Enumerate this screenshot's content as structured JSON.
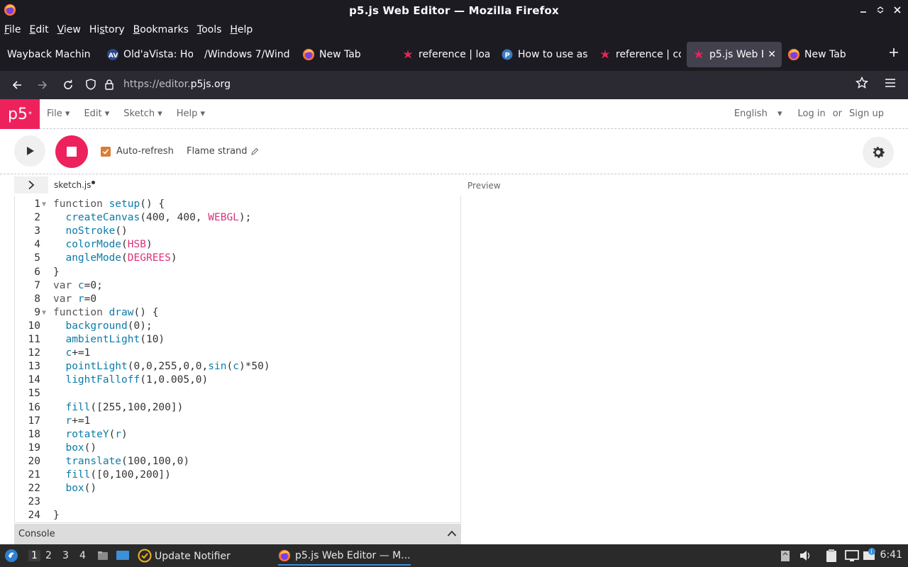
{
  "window": {
    "title": "p5.js Web Editor — Mozilla Firefox"
  },
  "menubar": [
    {
      "pre": "",
      "u": "F",
      "post": "ile"
    },
    {
      "pre": "",
      "u": "E",
      "post": "dit"
    },
    {
      "pre": "",
      "u": "V",
      "post": "iew"
    },
    {
      "pre": "Hi",
      "u": "s",
      "post": "tory"
    },
    {
      "pre": "",
      "u": "B",
      "post": "ookmarks"
    },
    {
      "pre": "",
      "u": "T",
      "post": "ools"
    },
    {
      "pre": "",
      "u": "H",
      "post": "elp"
    }
  ],
  "tabs": [
    {
      "label": "Wayback Machin",
      "icon": "none"
    },
    {
      "label": "Old'aVista: Ho",
      "icon": "av"
    },
    {
      "label": "/Windows 7/Wind",
      "icon": "none"
    },
    {
      "label": "New Tab",
      "icon": "firefox"
    },
    {
      "label": "reference | loa",
      "icon": "p5star"
    },
    {
      "label": "How to use as",
      "icon": "p"
    },
    {
      "label": "reference | co",
      "icon": "p5star"
    },
    {
      "label": "p5.js Web E",
      "icon": "p5star",
      "active": true
    },
    {
      "label": "New Tab",
      "icon": "firefox"
    }
  ],
  "urlbar": {
    "prefix": "https://editor.",
    "host": "p5js.org"
  },
  "p5": {
    "logo": "p5",
    "menu": [
      "File",
      "Edit",
      "Sketch",
      "Help"
    ],
    "language": "English",
    "login": "Log in",
    "or": "or",
    "signup": "Sign up"
  },
  "toolbar": {
    "autorefresh_label": "Auto-refresh",
    "autorefresh_checked": true,
    "sketch_name": "Flame strand"
  },
  "editor": {
    "file_name": "sketch.js",
    "preview_label": "Preview",
    "console_label": "Console",
    "lines": [
      {
        "n": "1",
        "fold": true,
        "tokens": [
          [
            "kw",
            "function "
          ],
          [
            "fn",
            "setup"
          ],
          [
            "plain",
            "() {"
          ]
        ]
      },
      {
        "n": "2",
        "tokens": [
          [
            "plain",
            "  "
          ],
          [
            "fn",
            "createCanvas"
          ],
          [
            "plain",
            "(400, 400, "
          ],
          [
            "const",
            "WEBGL"
          ],
          [
            "plain",
            ");"
          ]
        ]
      },
      {
        "n": "3",
        "tokens": [
          [
            "plain",
            "  "
          ],
          [
            "fn",
            "noStroke"
          ],
          [
            "plain",
            "()"
          ]
        ]
      },
      {
        "n": "4",
        "tokens": [
          [
            "plain",
            "  "
          ],
          [
            "fn",
            "colorMode"
          ],
          [
            "plain",
            "("
          ],
          [
            "const",
            "HSB"
          ],
          [
            "plain",
            ")"
          ]
        ]
      },
      {
        "n": "5",
        "tokens": [
          [
            "plain",
            "  "
          ],
          [
            "fn",
            "angleMode"
          ],
          [
            "plain",
            "("
          ],
          [
            "const",
            "DEGREES"
          ],
          [
            "plain",
            ")"
          ]
        ]
      },
      {
        "n": "6",
        "tokens": [
          [
            "plain",
            "}"
          ]
        ]
      },
      {
        "n": "7",
        "tokens": [
          [
            "kw",
            "var "
          ],
          [
            "fn",
            "c"
          ],
          [
            "plain",
            "=0;"
          ]
        ]
      },
      {
        "n": "8",
        "tokens": [
          [
            "kw",
            "var "
          ],
          [
            "fn",
            "r"
          ],
          [
            "plain",
            "=0"
          ]
        ]
      },
      {
        "n": "9",
        "fold": true,
        "tokens": [
          [
            "kw",
            "function "
          ],
          [
            "fn",
            "draw"
          ],
          [
            "plain",
            "() {"
          ]
        ]
      },
      {
        "n": "10",
        "tokens": [
          [
            "plain",
            "  "
          ],
          [
            "fn",
            "background"
          ],
          [
            "plain",
            "(0);"
          ]
        ]
      },
      {
        "n": "11",
        "tokens": [
          [
            "plain",
            "  "
          ],
          [
            "fn",
            "ambientLight"
          ],
          [
            "plain",
            "(10)"
          ]
        ]
      },
      {
        "n": "12",
        "tokens": [
          [
            "plain",
            "  "
          ],
          [
            "fn",
            "c"
          ],
          [
            "plain",
            "+=1"
          ]
        ]
      },
      {
        "n": "13",
        "tokens": [
          [
            "plain",
            "  "
          ],
          [
            "fn",
            "pointLight"
          ],
          [
            "plain",
            "(0,0,255,0,0,"
          ],
          [
            "fn",
            "sin"
          ],
          [
            "plain",
            "("
          ],
          [
            "fn",
            "c"
          ],
          [
            "plain",
            ")*50)"
          ]
        ]
      },
      {
        "n": "14",
        "tokens": [
          [
            "plain",
            "  "
          ],
          [
            "fn",
            "lightFalloff"
          ],
          [
            "plain",
            "(1,0.005,0)"
          ]
        ]
      },
      {
        "n": "15",
        "tokens": []
      },
      {
        "n": "16",
        "tokens": [
          [
            "plain",
            "  "
          ],
          [
            "fn",
            "fill"
          ],
          [
            "plain",
            "([255,100,200])"
          ]
        ]
      },
      {
        "n": "17",
        "tokens": [
          [
            "plain",
            "  "
          ],
          [
            "fn",
            "r"
          ],
          [
            "plain",
            "+=1"
          ]
        ]
      },
      {
        "n": "18",
        "tokens": [
          [
            "plain",
            "  "
          ],
          [
            "fn",
            "rotateY"
          ],
          [
            "plain",
            "("
          ],
          [
            "fn",
            "r"
          ],
          [
            "plain",
            ")"
          ]
        ]
      },
      {
        "n": "19",
        "tokens": [
          [
            "plain",
            "  "
          ],
          [
            "fn",
            "box"
          ],
          [
            "plain",
            "()"
          ]
        ]
      },
      {
        "n": "20",
        "tokens": [
          [
            "plain",
            "  "
          ],
          [
            "fn",
            "translate"
          ],
          [
            "plain",
            "(100,100,0)"
          ]
        ]
      },
      {
        "n": "21",
        "tokens": [
          [
            "plain",
            "  "
          ],
          [
            "fn",
            "fill"
          ],
          [
            "plain",
            "([0,100,200])"
          ]
        ]
      },
      {
        "n": "22",
        "tokens": [
          [
            "plain",
            "  "
          ],
          [
            "fn",
            "box"
          ],
          [
            "plain",
            "()"
          ]
        ]
      },
      {
        "n": "23",
        "tokens": []
      },
      {
        "n": "24",
        "tokens": [
          [
            "plain",
            "}"
          ]
        ]
      }
    ]
  },
  "taskbar": {
    "workspaces": [
      "1",
      "2",
      "3",
      "4"
    ],
    "active_workspace": "1",
    "tasks": [
      {
        "label": "Update Notifier",
        "active": false
      },
      {
        "label": "p5.js Web Editor — M...",
        "active": true
      }
    ],
    "clock": "6:41"
  },
  "colors": {
    "p5_accent": "#ed225d",
    "checkbox": "#d97e3a",
    "code_function": "#0b7ca9",
    "code_constant": "#d9317c"
  }
}
